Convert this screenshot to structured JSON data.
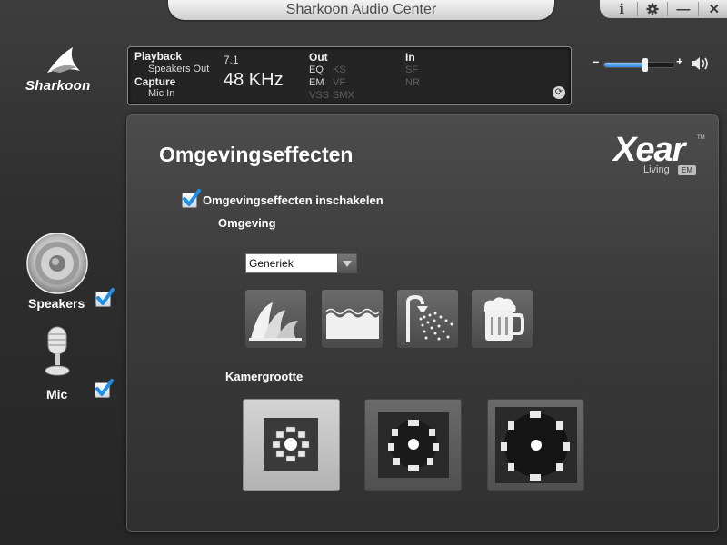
{
  "window": {
    "title": "Sharkoon Audio Center"
  },
  "controls": {
    "info": "i",
    "minimize": "—",
    "close": "✕"
  },
  "brand": {
    "name": "Sharkoon"
  },
  "status": {
    "playback_label": "Playback",
    "playback_device": "Speakers Out",
    "capture_label": "Capture",
    "capture_device": "Mic In",
    "channels": "7.1",
    "sample_rate": "48 KHz",
    "out_label": "Out",
    "out_items": [
      "EQ",
      "KS",
      "EM",
      "VF",
      "VSS",
      "SMX"
    ],
    "in_label": "In",
    "in_items": [
      "SF",
      "NR"
    ]
  },
  "volume": {
    "minus": "–",
    "plus": "+",
    "level": 0.58
  },
  "sidebar": {
    "devices": [
      {
        "label": "Speakers",
        "checked": true
      },
      {
        "label": "Mic",
        "checked": true
      }
    ]
  },
  "main": {
    "title": "Omgevingseffecten",
    "xear_logo": "Xear",
    "xear_tm": "TM",
    "xear_living": "Living",
    "xear_em": "EM",
    "enable_label": "Omgevingseffecten inschakelen",
    "enable_checked": true,
    "environment_label": "Omgeving",
    "preset_selected": "Generiek",
    "environment_icons": [
      "opera-house-icon",
      "water-icon",
      "shower-icon",
      "beer-mug-icon"
    ],
    "room_size_label": "Kamergrootte",
    "room_sizes": [
      "small-room-icon",
      "medium-room-icon",
      "large-room-icon"
    ],
    "room_size_selected": 0
  },
  "colors": {
    "accent": "#2f86e0",
    "check": "#1e8fe8"
  }
}
